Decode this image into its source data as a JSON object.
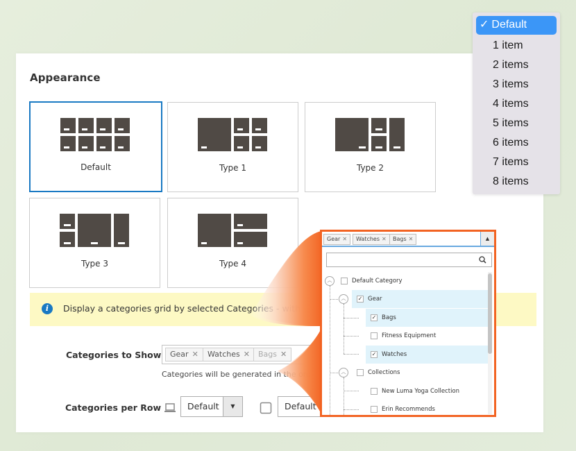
{
  "appearance": {
    "title": "Appearance",
    "layouts": [
      {
        "label": "Default",
        "selected": true
      },
      {
        "label": "Type 1",
        "selected": false
      },
      {
        "label": "Type 2",
        "selected": false
      },
      {
        "label": "Type 3",
        "selected": false
      },
      {
        "label": "Type 4",
        "selected": false
      }
    ]
  },
  "info": {
    "icon": "info-icon",
    "text": "Display a categories grid by selected Categories - with carousel,"
  },
  "categories_to_show": {
    "label": "Categories to Show",
    "tags": [
      "Gear",
      "Watches",
      "Bags"
    ],
    "remove_glyph": "✕",
    "hint": "Categories will be generated in the order you"
  },
  "categories_per_row": {
    "label": "Categories per Row",
    "desktop": {
      "icon": "laptop-icon",
      "value": "Default",
      "arrow": "▼"
    },
    "tablet": {
      "icon": "tablet-icon",
      "value": "Default"
    }
  },
  "popup": {
    "tags": [
      "Gear",
      "Watches",
      "Bags"
    ],
    "remove_glyph": "✕",
    "toggle_glyph": "▲",
    "search_placeholder": "",
    "tree": [
      {
        "label": "Default Category",
        "checked": false,
        "expandable": true,
        "level": 0,
        "highlighted": false
      },
      {
        "label": "Gear",
        "checked": true,
        "expandable": true,
        "level": 1,
        "highlighted": true
      },
      {
        "label": "Bags",
        "checked": true,
        "expandable": false,
        "level": 2,
        "highlighted": true
      },
      {
        "label": "Fitness Equipment",
        "checked": false,
        "expandable": false,
        "level": 2,
        "highlighted": false
      },
      {
        "label": "Watches",
        "checked": true,
        "expandable": false,
        "level": 2,
        "highlighted": true
      },
      {
        "label": "Collections",
        "checked": false,
        "expandable": true,
        "level": 1,
        "highlighted": false
      },
      {
        "label": "New Luma Yoga Collection",
        "checked": false,
        "expandable": false,
        "level": 2,
        "highlighted": false
      },
      {
        "label": "Erin Recommends",
        "checked": false,
        "expandable": false,
        "level": 2,
        "highlighted": false
      }
    ],
    "check_glyph": "✓",
    "collapse_glyph": "︿"
  },
  "dropdown": {
    "check_glyph": "✓",
    "selected": "Default",
    "options": [
      "Default",
      "1 item",
      "2 items",
      "3 items",
      "4 items",
      "5 items",
      "6 items",
      "7 items",
      "8 items"
    ]
  },
  "colors": {
    "accent_blue": "#1979c3",
    "highlight_orange": "#f26322",
    "tile_dark": "#504a45",
    "info_bg": "#fdf9c4",
    "dropdown_selected": "#3b96f7",
    "tree_highlight": "#e0f3fb"
  }
}
